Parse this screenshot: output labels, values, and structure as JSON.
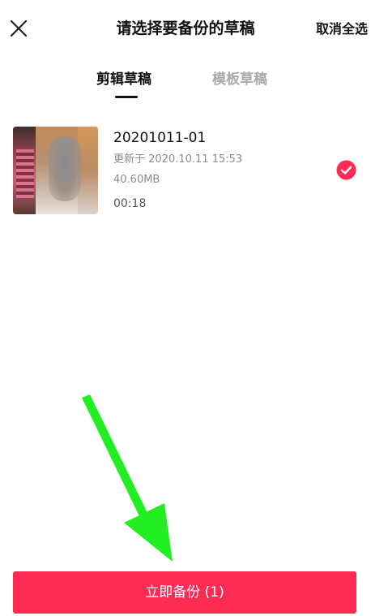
{
  "header": {
    "title": "请选择要备份的草稿",
    "deselect_all_label": "取消全选"
  },
  "tabs": [
    {
      "label": "剪辑草稿",
      "active": true
    },
    {
      "label": "模板草稿",
      "active": false
    }
  ],
  "drafts": [
    {
      "name": "20201011-01",
      "updated": "更新于 2020.10.11 15:53",
      "size": "40.60MB",
      "duration": "00:18",
      "selected": true
    }
  ],
  "backup_button": {
    "label": "立即备份 (1)"
  },
  "colors": {
    "accent": "#fe2c55",
    "annotation_arrow": "#22ee22",
    "tab_inactive": "#a9a9a9",
    "meta_text": "#8c8c8c"
  },
  "icons": {
    "close": "close-icon",
    "selected": "checkmark-circle-icon"
  }
}
